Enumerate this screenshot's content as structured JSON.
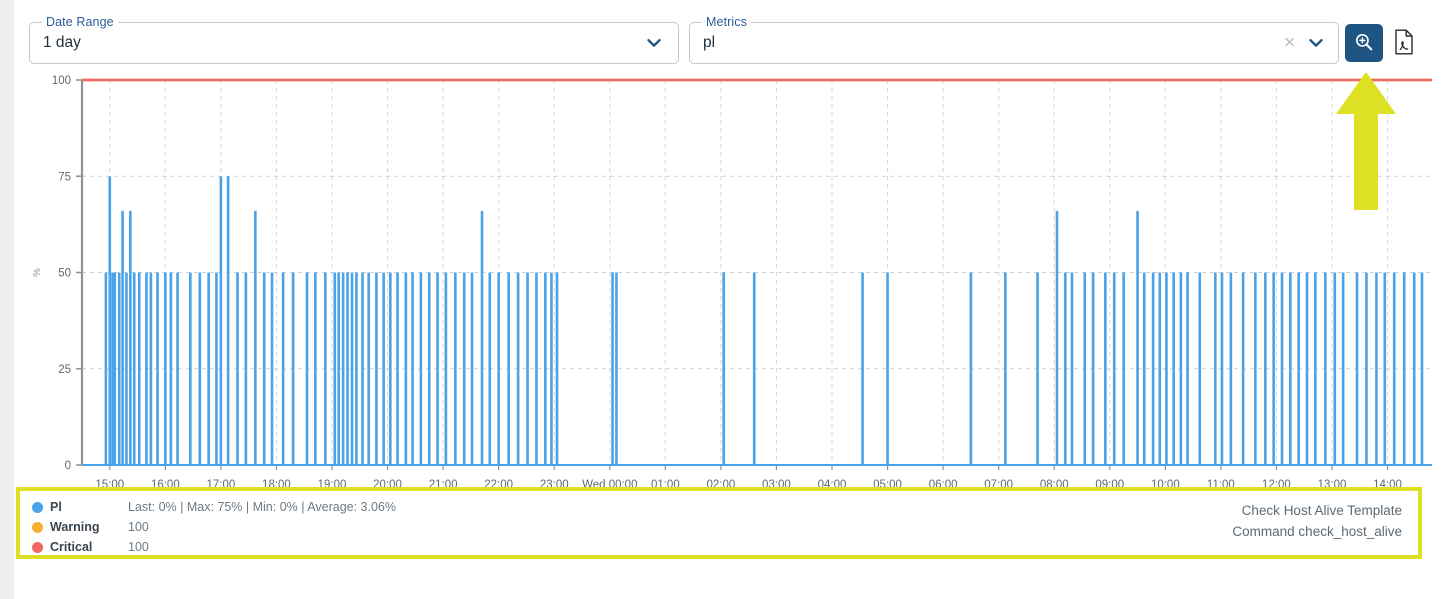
{
  "toolbar": {
    "date_range": {
      "label": "Date Range",
      "value": "1 day",
      "chevron_icon": "chevron-down-icon"
    },
    "metrics": {
      "label": "Metrics",
      "value": "pl",
      "placeholder": "",
      "clear_icon": "close-icon",
      "chevron_icon": "chevron-down-icon"
    },
    "search_button": {
      "icon": "magnifier-plus-icon",
      "color": "#1f5582"
    },
    "pdf_button": {
      "icon": "pdf-export-icon"
    }
  },
  "annotation": {
    "arrow_color": "#dde023",
    "box_color": "#dde023"
  },
  "legend": {
    "series": [
      {
        "name": "Pl",
        "color": "#4aa3e8",
        "stat": "Last: 0% | Max: 75% | Min: 0% | Average: 3.06%"
      },
      {
        "name": "Warning",
        "color": "#f5b034",
        "stat": "100"
      },
      {
        "name": "Critical",
        "color": "#f2675f",
        "stat": "100"
      }
    ],
    "meta": {
      "template": "Check Host Alive Template",
      "command": "Command check_host_alive"
    }
  },
  "chart_data": {
    "type": "line",
    "title": "",
    "xlabel": "",
    "ylabel": "%",
    "ylim": [
      0,
      100
    ],
    "yticks": [
      0,
      25,
      50,
      75,
      100
    ],
    "ytick_labels": [
      "0",
      "25",
      "50",
      "75",
      "100"
    ],
    "grid": true,
    "legend_position": "below",
    "x_tick_labels": [
      "15:00",
      "16:00",
      "17:00",
      "18:00",
      "19:00",
      "20:00",
      "21:00",
      "22:00",
      "23:00",
      "Wed 00:00",
      "01:00",
      "02:00",
      "03:00",
      "04:00",
      "05:00",
      "06:00",
      "07:00",
      "08:00",
      "09:00",
      "10:00",
      "11:00",
      "12:00",
      "13:00",
      "14:00"
    ],
    "x_range_hours": [
      14.5,
      38.8
    ],
    "series": [
      {
        "name": "Pl",
        "color": "#4aa3e8",
        "style": "spikes",
        "unit": "%",
        "baseline": 0,
        "stats": {
          "last": 0,
          "max": 75,
          "min": 0,
          "average": 3.06
        },
        "spikes": [
          [
            14.93,
            50
          ],
          [
            15.0,
            75
          ],
          [
            15.05,
            50
          ],
          [
            15.09,
            50
          ],
          [
            15.17,
            50
          ],
          [
            15.23,
            66
          ],
          [
            15.3,
            50
          ],
          [
            15.37,
            66
          ],
          [
            15.44,
            50
          ],
          [
            15.53,
            50
          ],
          [
            15.66,
            50
          ],
          [
            15.74,
            50
          ],
          [
            15.86,
            50
          ],
          [
            16.0,
            50
          ],
          [
            16.1,
            50
          ],
          [
            16.22,
            50
          ],
          [
            16.45,
            50
          ],
          [
            16.62,
            50
          ],
          [
            16.78,
            50
          ],
          [
            16.92,
            50
          ],
          [
            17.0,
            75
          ],
          [
            17.13,
            75
          ],
          [
            17.3,
            50
          ],
          [
            17.45,
            50
          ],
          [
            17.62,
            66
          ],
          [
            17.78,
            50
          ],
          [
            17.92,
            50
          ],
          [
            18.12,
            50
          ],
          [
            18.3,
            50
          ],
          [
            18.55,
            50
          ],
          [
            18.7,
            50
          ],
          [
            18.88,
            50
          ],
          [
            19.05,
            50
          ],
          [
            19.12,
            50
          ],
          [
            19.2,
            50
          ],
          [
            19.28,
            50
          ],
          [
            19.36,
            50
          ],
          [
            19.44,
            50
          ],
          [
            19.55,
            50
          ],
          [
            19.66,
            50
          ],
          [
            19.8,
            50
          ],
          [
            19.93,
            50
          ],
          [
            20.05,
            50
          ],
          [
            20.18,
            50
          ],
          [
            20.33,
            50
          ],
          [
            20.45,
            50
          ],
          [
            20.6,
            50
          ],
          [
            20.75,
            50
          ],
          [
            20.9,
            50
          ],
          [
            21.05,
            50
          ],
          [
            21.22,
            50
          ],
          [
            21.38,
            50
          ],
          [
            21.52,
            50
          ],
          [
            21.7,
            66
          ],
          [
            21.84,
            50
          ],
          [
            22.0,
            50
          ],
          [
            22.18,
            50
          ],
          [
            22.35,
            50
          ],
          [
            22.52,
            50
          ],
          [
            22.68,
            50
          ],
          [
            22.84,
            50
          ],
          [
            22.95,
            50
          ],
          [
            23.05,
            50
          ],
          [
            24.05,
            50
          ],
          [
            24.12,
            50
          ],
          [
            26.05,
            50
          ],
          [
            26.6,
            50
          ],
          [
            28.55,
            50
          ],
          [
            29.0,
            50
          ],
          [
            30.5,
            50
          ],
          [
            31.12,
            50
          ],
          [
            31.7,
            50
          ],
          [
            32.05,
            66
          ],
          [
            32.2,
            50
          ],
          [
            32.32,
            50
          ],
          [
            32.55,
            50
          ],
          [
            32.7,
            50
          ],
          [
            32.92,
            50
          ],
          [
            33.08,
            50
          ],
          [
            33.25,
            50
          ],
          [
            33.5,
            66
          ],
          [
            33.62,
            50
          ],
          [
            33.78,
            50
          ],
          [
            33.9,
            50
          ],
          [
            34.02,
            50
          ],
          [
            34.15,
            50
          ],
          [
            34.28,
            50
          ],
          [
            34.4,
            50
          ],
          [
            34.62,
            50
          ],
          [
            34.9,
            50
          ],
          [
            35.02,
            50
          ],
          [
            35.18,
            50
          ],
          [
            35.4,
            50
          ],
          [
            35.62,
            50
          ],
          [
            35.8,
            50
          ],
          [
            35.95,
            50
          ],
          [
            36.1,
            50
          ],
          [
            36.25,
            50
          ],
          [
            36.4,
            50
          ],
          [
            36.55,
            50
          ],
          [
            36.7,
            50
          ],
          [
            36.88,
            50
          ],
          [
            37.05,
            50
          ],
          [
            37.2,
            50
          ],
          [
            37.45,
            50
          ],
          [
            37.62,
            50
          ],
          [
            37.8,
            50
          ],
          [
            37.95,
            50
          ],
          [
            38.12,
            50
          ],
          [
            38.3,
            50
          ],
          [
            38.48,
            50
          ],
          [
            38.62,
            50
          ]
        ]
      },
      {
        "name": "Warning",
        "color": "#f5b034",
        "style": "threshold-line",
        "value": 100
      },
      {
        "name": "Critical",
        "color": "#f2675f",
        "style": "threshold-line",
        "value": 100
      }
    ]
  }
}
